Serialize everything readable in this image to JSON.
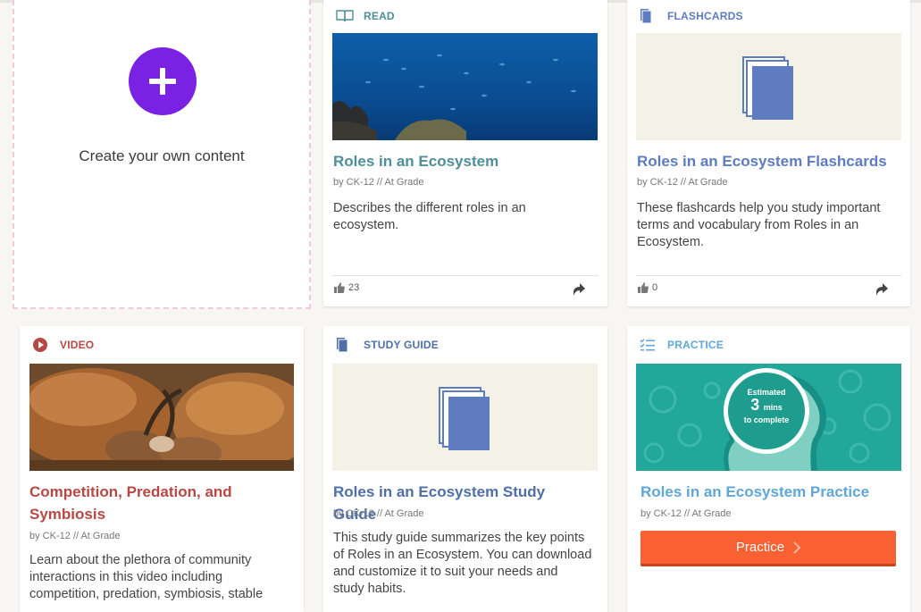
{
  "create": {
    "label": "Create your own content"
  },
  "colors": {
    "read": "#4e8f99",
    "flashcards": "#5e7cbf",
    "video": "#b84843",
    "study_guide": "#4f6fa8",
    "practice": "#5fa7d8",
    "create_button": "#7a22e3",
    "practice_button": "#fa6132"
  },
  "cards": [
    {
      "type": "READ",
      "icon": "book-icon",
      "title": "Roles in an Ecosystem",
      "meta": "by CK-12  //  At Grade",
      "description": "Describes the different roles in an ecosystem.",
      "likes": "23"
    },
    {
      "type": "FLASHCARDS",
      "icon": "flashcards-icon",
      "title": "Roles in an Ecosystem Flashcards",
      "meta": "by CK-12  //  At Grade",
      "description": "These flashcards help you study important terms and vocabulary from Roles in an Ecosystem.",
      "likes": "0"
    },
    {
      "type": "VIDEO",
      "icon": "play-circle-icon",
      "title": "Competition, Predation, and Symbiosis",
      "meta": "by CK-12  //  At Grade",
      "description": "Learn about the plethora of community interactions in this video including competition, predation, symbiosis, stable"
    },
    {
      "type": "STUDY GUIDE",
      "icon": "study-guide-icon",
      "title": "Roles in an Ecosystem Study Guide",
      "meta": "by CK-12  //  At Grade",
      "description": "This study guide summarizes the key points of Roles in an Ecosystem. You can download and customize it to suit your needs and study habits."
    },
    {
      "type": "PRACTICE",
      "icon": "checklist-icon",
      "title": "Roles in an Ecosystem Practice",
      "meta": "by CK-12  //  At Grade",
      "estimate": {
        "top": "Estimated",
        "number": "3",
        "unit": "mins",
        "bottom": "to complete"
      },
      "button_label": "Practice"
    }
  ]
}
